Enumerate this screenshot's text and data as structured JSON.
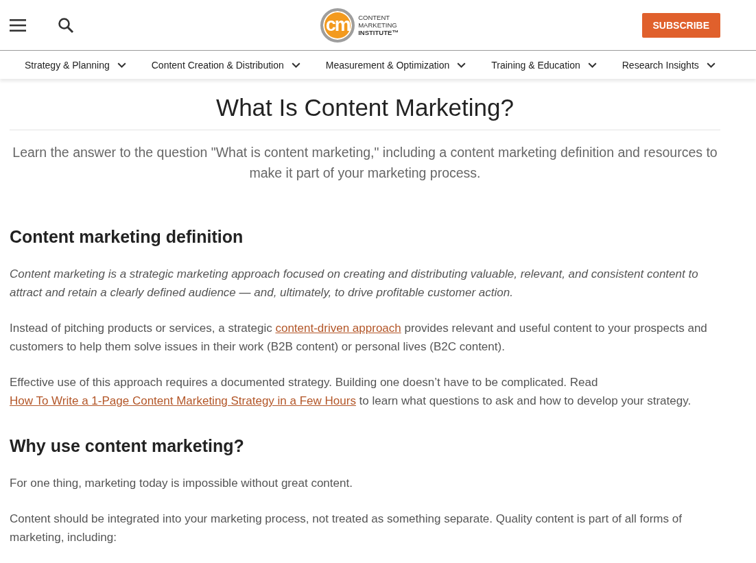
{
  "header": {
    "logo": {
      "mark": "cm",
      "lines": [
        "CONTENT",
        "MARKETING",
        "INSTITUTE™"
      ]
    },
    "subscribe": "SUBSCRIBE"
  },
  "nav": [
    {
      "label": "Strategy & Planning"
    },
    {
      "label": "Content Creation & Distribution"
    },
    {
      "label": "Measurement & Optimization"
    },
    {
      "label": "Training & Education"
    },
    {
      "label": "Research Insights"
    }
  ],
  "article": {
    "title": "What Is Content Marketing?",
    "intro": "Learn the answer to the question \"What is content marketing,\" including a content marketing definition and resources to make it part of your marketing process.",
    "blocks": [
      {
        "kind": "heading",
        "text": "Content marketing definition"
      },
      {
        "kind": "quote",
        "parts": [
          {
            "text": "Content marketing is a strategic marketing approach focused on creating and distributing valuable, relevant, and consistent content to attract and retain a clearly defined audience — and, ultimately, to drive profitable customer action."
          }
        ]
      },
      {
        "kind": "paragraph",
        "parts": [
          {
            "text": "Instead of pitching products or services, a strategic "
          },
          {
            "text": "content-driven approach",
            "kind": "link"
          },
          {
            "text": " provides relevant and useful content to your prospects and customers to help them solve issues in their work (B2B content) or personal lives (B2C content)."
          }
        ]
      },
      {
        "kind": "paragraph",
        "parts": [
          {
            "text": "Effective use of this approach requires a documented strategy. Building one doesn’t have to be complicated. Read "
          },
          {
            "text": "How To Write a 1-Page Content Marketing Strategy in a Few Hours",
            "kind": "link"
          },
          {
            "text": " to learn what questions to ask and how to develop your strategy."
          }
        ]
      },
      {
        "kind": "heading",
        "text": "Why use content marketing?"
      },
      {
        "kind": "paragraph",
        "parts": [
          {
            "text": "For one thing, marketing today is impossible without great content."
          }
        ]
      },
      {
        "kind": "paragraph",
        "parts": [
          {
            "text": "Content should be integrated into your marketing process, not treated as something separate. Quality content is part of all forms of marketing, including:"
          }
        ]
      }
    ]
  }
}
